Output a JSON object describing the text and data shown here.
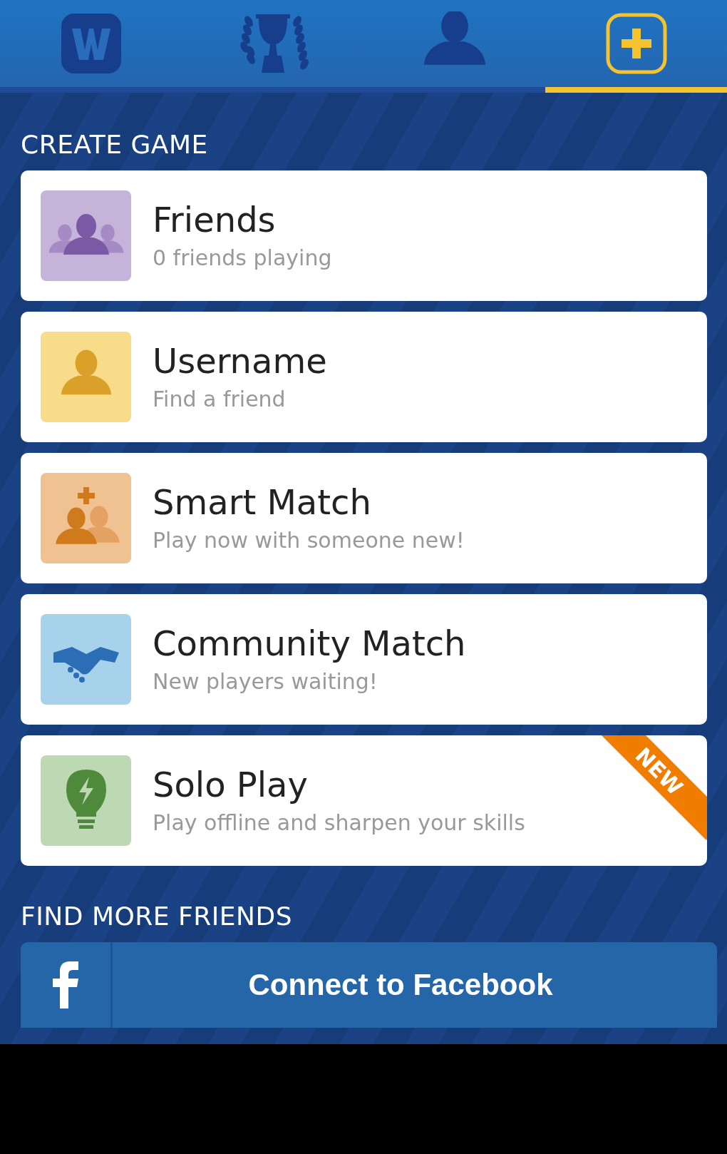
{
  "tabs": [
    {
      "kind": "word",
      "selected": false
    },
    {
      "kind": "trophy",
      "selected": false
    },
    {
      "kind": "profile",
      "selected": false
    },
    {
      "kind": "new-game",
      "selected": true
    }
  ],
  "create_game": {
    "heading": "CREATE GAME",
    "options": [
      {
        "kind": "friends",
        "title": "Friends",
        "subtitle": "0 friends playing"
      },
      {
        "kind": "username",
        "title": "Username",
        "subtitle": "Find a friend"
      },
      {
        "kind": "smart",
        "title": "Smart Match",
        "subtitle": "Play now with someone new!"
      },
      {
        "kind": "community",
        "title": "Community Match",
        "subtitle": "New players waiting!"
      },
      {
        "kind": "solo",
        "title": "Solo Play",
        "subtitle": "Play offline and sharpen your skills",
        "badge": "NEW"
      }
    ]
  },
  "find_friends": {
    "heading": "FIND MORE FRIENDS",
    "button": "Connect to Facebook"
  }
}
